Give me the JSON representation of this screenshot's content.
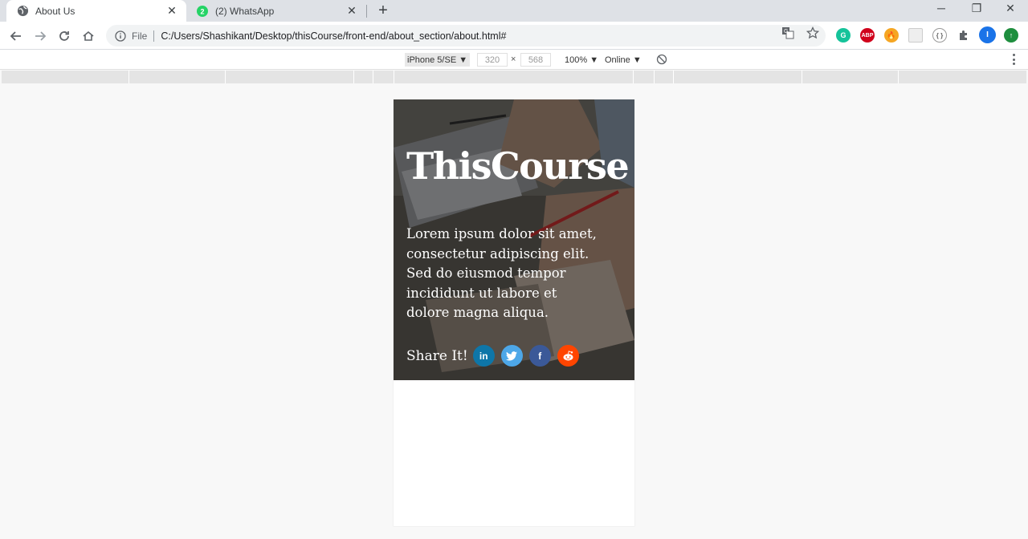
{
  "tabs": [
    {
      "title": "About Us",
      "icon": "globe-icon"
    },
    {
      "title": "(2) WhatsApp",
      "icon": "whatsapp-icon",
      "badge": "2"
    }
  ],
  "omnibox": {
    "scheme": "File",
    "url": "C:/Users/Shashikant/Desktop/thisCourse/front-end/about_section/about.html#"
  },
  "device_toolbar": {
    "device": "iPhone 5/SE ▼",
    "width": "320",
    "height": "568",
    "times": "×",
    "zoom": "100% ▼",
    "network": "Online ▼"
  },
  "page": {
    "brand": "ThisCourse",
    "description": "Lorem ipsum dolor sit amet, consectetur adipiscing elit. Sed do eiusmod tempor incididunt ut labore et dolore magna aliqua.",
    "share_label": "Share It!",
    "social": [
      {
        "name": "linkedin",
        "glyph": "in",
        "color": "#0e76a8"
      },
      {
        "name": "twitter",
        "glyph": "t",
        "color": "#4da7e8"
      },
      {
        "name": "facebook",
        "glyph": "f",
        "color": "#3b5998"
      },
      {
        "name": "reddit",
        "glyph": "r",
        "color": "#ff4500"
      }
    ]
  },
  "colors": {
    "tabstrip": "#dee1e6",
    "toolbar": "#ffffff",
    "page_bg": "#f8f8f8"
  }
}
